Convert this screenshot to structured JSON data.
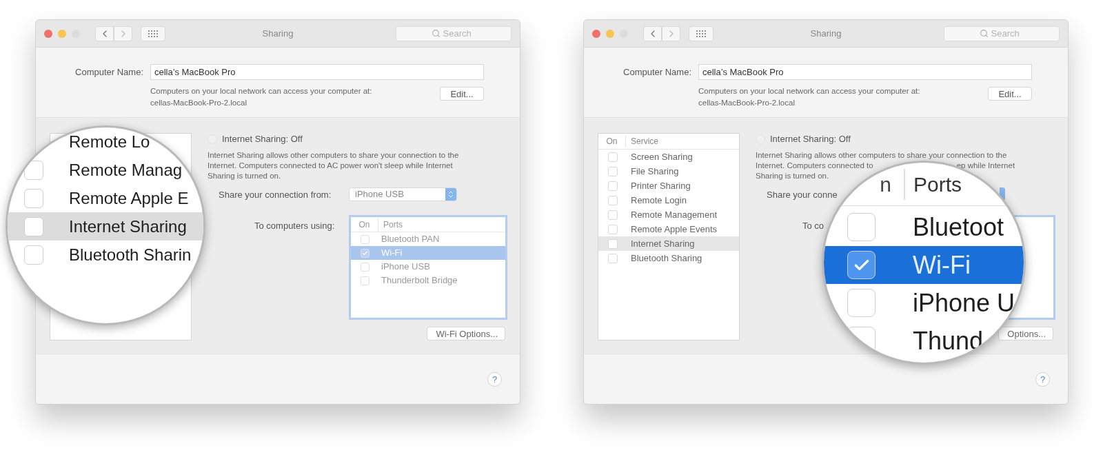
{
  "windows": [
    {
      "title": "Sharing",
      "search": {
        "placeholder": "Search"
      },
      "computer_name": {
        "label": "Computer Name:",
        "value": "cella’s MacBook Pro"
      },
      "address_note": [
        "Computers on your local network can access your computer at:",
        "cellas-MacBook-Pro-2.local"
      ],
      "edit_button": "Edit...",
      "status": {
        "label": "Internet Sharing: Off",
        "checked": false
      },
      "description": [
        [
          "Internet Sharing allows other computers to share your connection to the"
        ],
        [
          "Internet. Computers connected to AC power won't sleep while Internet"
        ],
        [
          "Sharing is turned on."
        ]
      ],
      "share_from": {
        "label": "Share your connection from:",
        "value": "iPhone USB"
      },
      "to_computers": {
        "label": "To computers using:",
        "columns": [
          "On",
          "Ports"
        ],
        "rows": [
          {
            "label": "Bluetooth PAN",
            "checked": false,
            "selected": false
          },
          {
            "label": "Wi-Fi",
            "checked": true,
            "selected": true
          },
          {
            "label": "iPhone USB",
            "checked": false,
            "selected": false
          },
          {
            "label": "Thunderbolt Bridge",
            "checked": false,
            "selected": false
          }
        ]
      },
      "options_button": "Wi-Fi Options...",
      "help_button": "?",
      "magnifier": {
        "kind": "services",
        "rows": [
          {
            "label": "Remote Lo",
            "selected": false
          },
          {
            "label": "Remote Manag",
            "checked": false,
            "selected": false
          },
          {
            "label": "Remote Apple E",
            "checked": false,
            "selected": false
          },
          {
            "label": "Internet Sharing",
            "checked": false,
            "selected": true
          },
          {
            "label": "Bluetooth Sharin",
            "checked": false,
            "selected": false
          }
        ]
      }
    },
    {
      "title": "Sharing",
      "search": {
        "placeholder": "Search"
      },
      "computer_name": {
        "label": "Computer Name:",
        "value": "cella’s MacBook Pro"
      },
      "address_note": [
        "Computers on your local network can access your computer at:",
        "cellas-MacBook-Pro-2.local"
      ],
      "edit_button": "Edit...",
      "services": {
        "columns": [
          "On",
          "Service"
        ],
        "rows": [
          {
            "label": "Screen Sharing",
            "checked": false,
            "selected": false
          },
          {
            "label": "File Sharing",
            "checked": false,
            "selected": false
          },
          {
            "label": "Printer Sharing",
            "checked": false,
            "selected": false
          },
          {
            "label": "Remote Login",
            "checked": false,
            "selected": false
          },
          {
            "label": "Remote Management",
            "checked": false,
            "selected": false
          },
          {
            "label": "Remote Apple Events",
            "checked": false,
            "selected": false
          },
          {
            "label": "Internet Sharing",
            "checked": false,
            "selected": true
          },
          {
            "label": "Bluetooth Sharing",
            "checked": false,
            "selected": false
          }
        ]
      },
      "status": {
        "label": "Internet Sharing: Off",
        "checked": false
      },
      "description": [
        [
          "Internet Sharing allows other computers to share your connection to the"
        ],
        [
          "Internet. Computers connected to",
          "ep while Internet"
        ],
        [
          "Sharing is turned on."
        ]
      ],
      "share_from": {
        "label": "Share your conne"
      },
      "to_computers": {
        "label": "To co"
      },
      "options_button": "Options...",
      "help_button": "?",
      "magnifier": {
        "kind": "ports",
        "columns": [
          "n",
          "Ports"
        ],
        "rows": [
          {
            "label": "Bluetoot",
            "checked": false,
            "selected": false
          },
          {
            "label": "Wi-Fi",
            "checked": true,
            "selected": true
          },
          {
            "label": "iPhone U",
            "checked": false,
            "selected": false
          },
          {
            "label": "Thund",
            "checked": false,
            "selected": false
          }
        ]
      }
    }
  ]
}
